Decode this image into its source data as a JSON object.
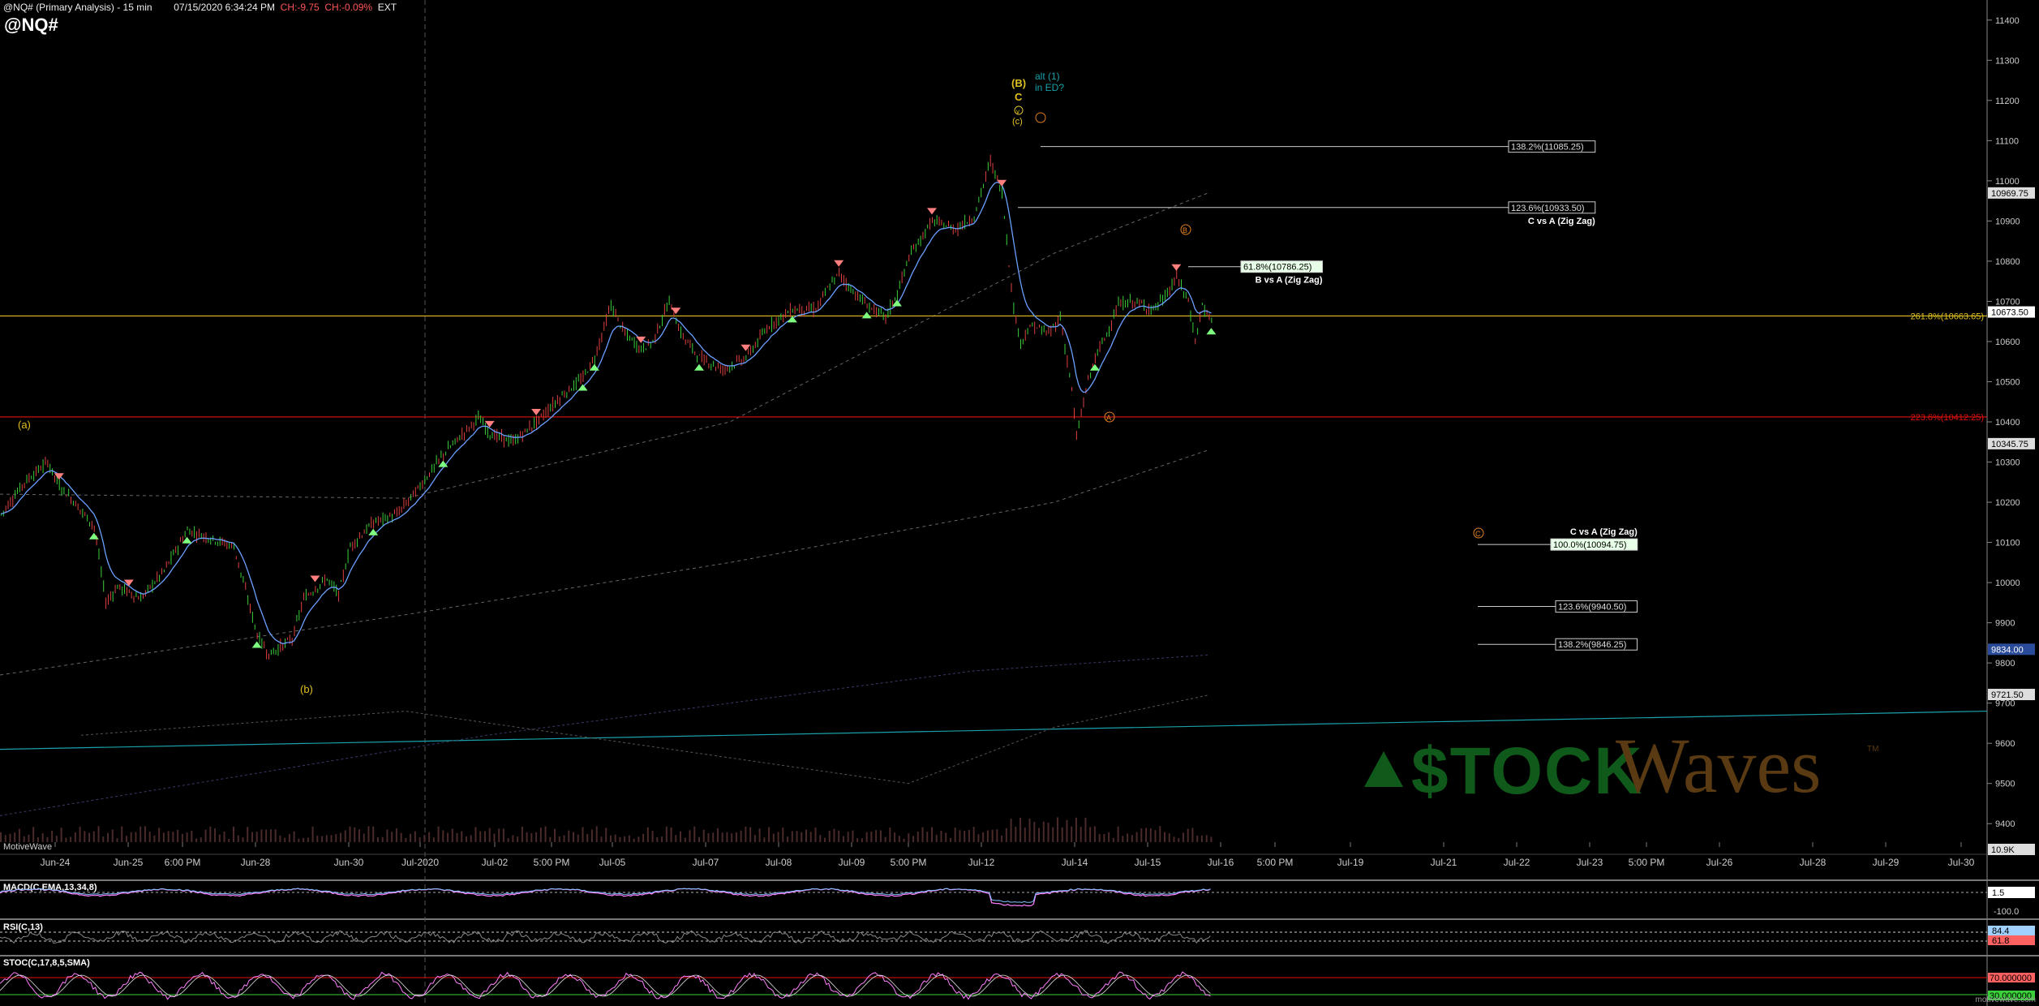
{
  "header": {
    "title": "@NQ# (Primary Analysis) - 15 min",
    "datetime": "07/15/2020 6:34:24 PM",
    "change_points": "CH:-9.75",
    "change_pct": "CH:-0.09%",
    "session": "EXT",
    "symbol": "@NQ#"
  },
  "colors": {
    "background": "#000000",
    "accent_yellow": "#e0c020",
    "accent_red": "#e01010",
    "teal": "#1aa0a8",
    "bull_arrow": "#7fff7f",
    "bear_arrow": "#ff7f7f",
    "logo_green": "#0f5a1a",
    "logo_brown": "#5a3a12"
  },
  "watermark": {
    "left": "MotiveWave",
    "footer": "motivewave.com",
    "logo_stock": "$TOCK",
    "logo_waves": "Waves",
    "logo_tm": "TM"
  },
  "chart_data": [
    {
      "type": "candlestick",
      "interval": "15 min",
      "y_axis": {
        "min": 9350,
        "max": 11450,
        "ticks": [
          9400,
          9500,
          9600,
          9700,
          9800,
          9900,
          10000,
          10100,
          10200,
          10300,
          10400,
          10500,
          10600,
          10700,
          10800,
          10900,
          11000,
          11100,
          11200,
          11300,
          11400
        ]
      },
      "x_labels": [
        "Jun-24",
        "Jun-25",
        "6:00 PM",
        "Jun-28",
        "Jun-30",
        "Jul-2020",
        "Jul-02",
        "5:00 PM",
        "Jul-05",
        "Jul-07",
        "Jul-08",
        "Jul-09",
        "5:00 PM",
        "Jul-12",
        "Jul-14",
        "Jul-15",
        "Jul-16",
        "5:00 PM",
        "Jul-19",
        "Jul-21",
        "Jul-22",
        "Jul-23",
        "5:00 PM",
        "Jul-26",
        "Jul-28",
        "Jul-29",
        "Jul-30"
      ],
      "price_path": [
        [
          0,
          10170
        ],
        [
          10,
          10250
        ],
        [
          20,
          10300
        ],
        [
          25,
          10240
        ],
        [
          30,
          10210
        ],
        [
          40,
          10140
        ],
        [
          45,
          9950
        ],
        [
          50,
          9990
        ],
        [
          60,
          9960
        ],
        [
          70,
          10030
        ],
        [
          80,
          10130
        ],
        [
          90,
          10110
        ],
        [
          100,
          10090
        ],
        [
          110,
          9870
        ],
        [
          115,
          9820
        ],
        [
          120,
          9840
        ],
        [
          125,
          9860
        ],
        [
          130,
          9960
        ],
        [
          140,
          10010
        ],
        [
          145,
          9970
        ],
        [
          150,
          10090
        ],
        [
          160,
          10150
        ],
        [
          170,
          10170
        ],
        [
          180,
          10240
        ],
        [
          190,
          10320
        ],
        [
          200,
          10380
        ],
        [
          205,
          10410
        ],
        [
          210,
          10370
        ],
        [
          220,
          10350
        ],
        [
          230,
          10400
        ],
        [
          240,
          10460
        ],
        [
          250,
          10510
        ],
        [
          255,
          10560
        ],
        [
          262,
          10690
        ],
        [
          268,
          10620
        ],
        [
          275,
          10580
        ],
        [
          280,
          10600
        ],
        [
          287,
          10700
        ],
        [
          292,
          10620
        ],
        [
          300,
          10560
        ],
        [
          310,
          10530
        ],
        [
          320,
          10560
        ],
        [
          330,
          10640
        ],
        [
          340,
          10680
        ],
        [
          350,
          10680
        ],
        [
          355,
          10730
        ],
        [
          360,
          10770
        ],
        [
          365,
          10730
        ],
        [
          372,
          10690
        ],
        [
          380,
          10660
        ],
        [
          385,
          10720
        ],
        [
          390,
          10810
        ],
        [
          400,
          10900
        ],
        [
          410,
          10880
        ],
        [
          418,
          10910
        ],
        [
          425,
          11050
        ],
        [
          430,
          10970
        ],
        [
          435,
          10680
        ],
        [
          438,
          10600
        ],
        [
          443,
          10640
        ],
        [
          450,
          10620
        ],
        [
          455,
          10660
        ],
        [
          460,
          10480
        ],
        [
          462,
          10360
        ],
        [
          466,
          10480
        ],
        [
          470,
          10560
        ],
        [
          475,
          10620
        ],
        [
          480,
          10690
        ],
        [
          486,
          10700
        ],
        [
          495,
          10680
        ],
        [
          500,
          10710
        ],
        [
          505,
          10760
        ],
        [
          510,
          10700
        ],
        [
          513,
          10600
        ],
        [
          516,
          10690
        ],
        [
          520,
          10650
        ]
      ],
      "current_price": 10673.5,
      "right_badges": [
        {
          "label": "10969.75",
          "price": 10969.75
        },
        {
          "label": "10673.50",
          "price": 10673.5
        },
        {
          "label": "10345.75",
          "price": 10345.75
        },
        {
          "label": "9834.00",
          "price": 9834
        },
        {
          "label": "9721.50",
          "price": 9721.5
        },
        {
          "label": "10.9K",
          "price": 9365
        }
      ],
      "horizontal_levels": [
        {
          "label": "261.8%(10663.65)",
          "price": 10663.65,
          "color": "yellow"
        },
        {
          "label": "223.6%(10412.25)",
          "price": 10412.25,
          "color": "red"
        }
      ],
      "fib_targets": [
        {
          "label": "138.2%(11085.25)",
          "price": 11085.25,
          "note": ""
        },
        {
          "label": "123.6%(10933.50)",
          "price": 10933.5,
          "note": "C vs A (Zig Zag)"
        },
        {
          "label": "61.8%(10786.25)",
          "price": 10786.25,
          "note": "B vs A (Zig Zag)"
        },
        {
          "label": "100.0%(10094.75)",
          "price": 10094.75,
          "note": "C vs A (Zig Zag)"
        },
        {
          "label": "123.6%(9940.50)",
          "price": 9940.5,
          "note": ""
        },
        {
          "label": "138.2%(9846.25)",
          "price": 9846.25,
          "note": ""
        }
      ],
      "wave_labels": [
        {
          "text": "(a)"
        },
        {
          "text": "(b)"
        },
        {
          "text": "(B)"
        },
        {
          "text": "C"
        },
        {
          "text": "v"
        },
        {
          "text": "(c)"
        },
        {
          "text": "alt (1)"
        },
        {
          "text": "in ED?"
        },
        {
          "text": "A"
        },
        {
          "text": "B"
        },
        {
          "text": "C"
        }
      ]
    },
    {
      "type": "line",
      "name": "MACD(C,EMA,13,34,8)",
      "badge": "1.5",
      "tick": "-100.0"
    },
    {
      "type": "line",
      "name": "RSI(C,13)",
      "badges": [
        "84.4",
        "61.8"
      ]
    },
    {
      "type": "line",
      "name": "STOC(C,17,8,5,SMA)",
      "badges": [
        "70.000000",
        "30.000000"
      ]
    }
  ]
}
